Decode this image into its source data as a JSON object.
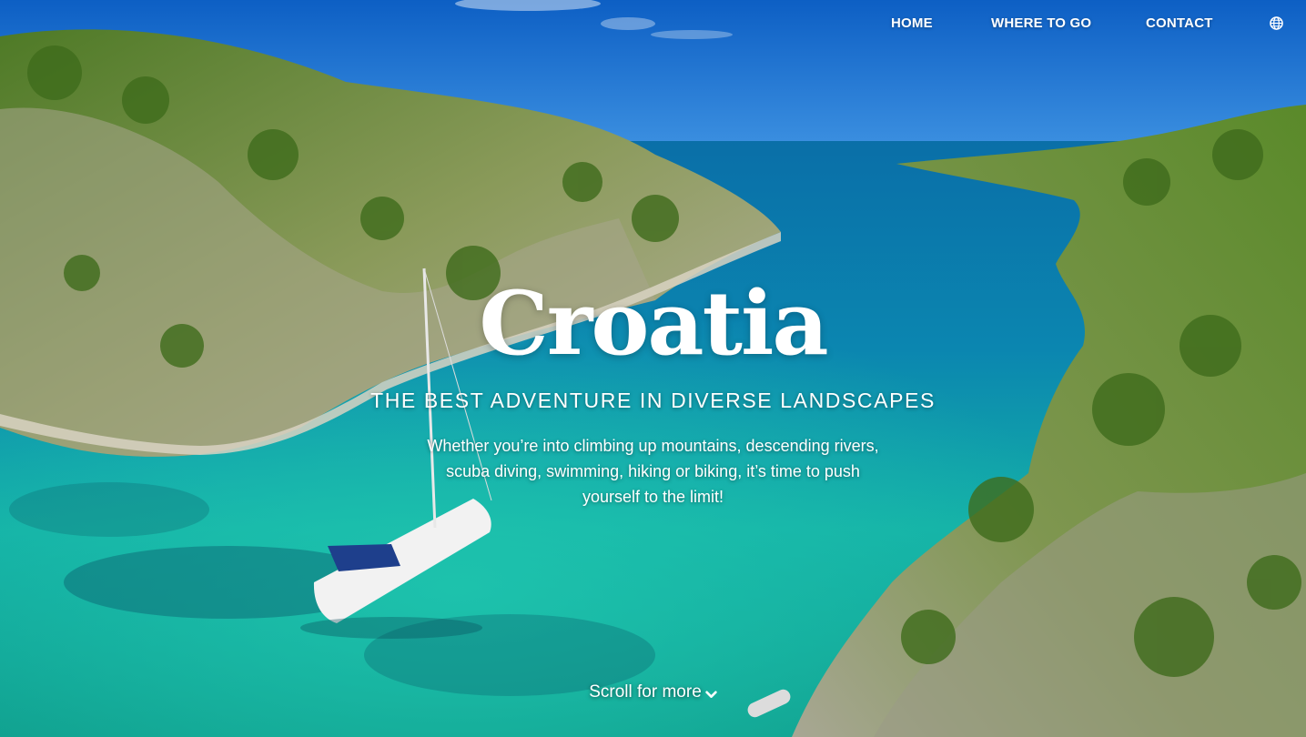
{
  "nav": {
    "home": "HOME",
    "where_to_go": "WHERE TO GO",
    "contact": "CONTACT",
    "language_icon": "globe-icon"
  },
  "hero": {
    "title": "Croatia",
    "subtitle": "THE BEST ADVENTURE IN DIVERSE LANDSCAPES",
    "description": "Whether you’re into climbing up mountains, descending rivers, scuba diving, swimming, hiking or biking, it’s time to push yourself to the limit!",
    "scroll_label": "Scroll for more",
    "scroll_icon": "chevron-down-icon"
  },
  "colors": {
    "sky": "#1a6fd0",
    "sea_deep": "#0a7fb8",
    "sea_shallow": "#17b8a8",
    "land": "#6f8a3a",
    "text": "#ffffff"
  }
}
